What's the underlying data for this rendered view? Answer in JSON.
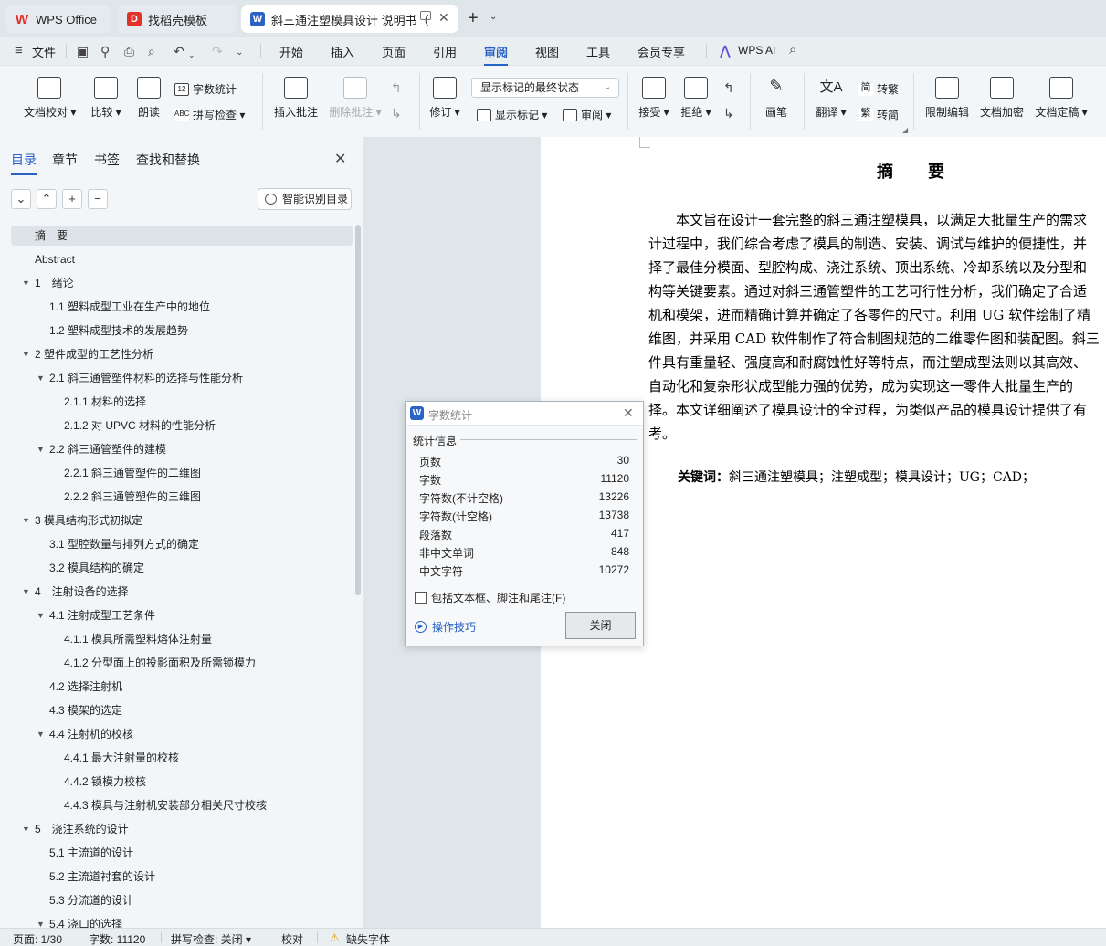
{
  "tabs": [
    {
      "label": "WPS Office"
    },
    {
      "label": "找稻壳模板"
    },
    {
      "label": "斜三通注塑模具设计 说明书（"
    }
  ],
  "menu": {
    "file": "文件",
    "items": [
      "开始",
      "插入",
      "页面",
      "引用",
      "审阅",
      "视图",
      "工具",
      "会员专享"
    ],
    "active": "审阅",
    "ai": "WPS AI"
  },
  "ribbon": {
    "doc_check": "文档校对",
    "compare": "比较",
    "read_aloud": "朗读",
    "word_count": "字数统计",
    "spell_check": "拼写检查",
    "insert_comment": "插入批注",
    "delete_comment": "删除批注",
    "revise": "修订",
    "markup_state": "显示标记的最终状态",
    "show_markup": "显示标记",
    "review_pane": "审阅",
    "accept": "接受",
    "reject": "拒绝",
    "pen": "画笔",
    "translate": "翻译",
    "to_traditional": "转繁",
    "to_simplified": "转简",
    "restrict_edit": "限制编辑",
    "encrypt": "文档加密",
    "finalize": "文档定稿"
  },
  "nav": {
    "tabs": [
      "目录",
      "章节",
      "书签",
      "查找和替换"
    ],
    "smart_toc": "智能识别目录",
    "toc": [
      {
        "text": "摘　要",
        "level": 1,
        "caret": false,
        "selected": true
      },
      {
        "text": "Abstract",
        "level": 1,
        "caret": false
      },
      {
        "text": "1　绪论",
        "level": 1,
        "caret": true
      },
      {
        "text": "1.1  塑料成型工业在生产中的地位",
        "level": 2,
        "caret": false
      },
      {
        "text": "1.2  塑料成型技术的发展趋势",
        "level": 2,
        "caret": false
      },
      {
        "text": "2 塑件成型的工艺性分析",
        "level": 1,
        "caret": true
      },
      {
        "text": "2.1 斜三通管塑件材料的选择与性能分析",
        "level": 2,
        "caret": true
      },
      {
        "text": "2.1.1 材料的选择",
        "level": 3,
        "caret": false
      },
      {
        "text": "2.1.2  对 UPVC 材料的性能分析",
        "level": 3,
        "caret": false
      },
      {
        "text": "2.2 斜三通管塑件的建模",
        "level": 2,
        "caret": true
      },
      {
        "text": "2.2.1 斜三通管塑件的二维图",
        "level": 3,
        "caret": false
      },
      {
        "text": "2.2.2 斜三通管塑件的三维图",
        "level": 3,
        "caret": false
      },
      {
        "text": "3 模具结构形式初拟定",
        "level": 1,
        "caret": true
      },
      {
        "text": "3.1 型腔数量与排列方式的确定",
        "level": 2,
        "caret": false
      },
      {
        "text": "3.2 模具结构的确定",
        "level": 2,
        "caret": false
      },
      {
        "text": "4　注射设备的选择",
        "level": 1,
        "caret": true
      },
      {
        "text": "4.1  注射成型工艺条件",
        "level": 2,
        "caret": true
      },
      {
        "text": "4.1.1  模具所需塑料熔体注射量",
        "level": 3,
        "caret": false
      },
      {
        "text": "4.1.2  分型面上的投影面积及所需锁模力",
        "level": 3,
        "caret": false
      },
      {
        "text": "4.2  选择注射机",
        "level": 2,
        "caret": false
      },
      {
        "text": "4.3  模架的选定",
        "level": 2,
        "caret": false
      },
      {
        "text": "4.4  注射机的校核",
        "level": 2,
        "caret": true
      },
      {
        "text": "4.4.1  最大注射量的校核",
        "level": 3,
        "caret": false
      },
      {
        "text": "4.4.2  锁模力校核",
        "level": 3,
        "caret": false
      },
      {
        "text": "4.4.3  模具与注射机安装部分相关尺寸校核",
        "level": 3,
        "caret": false
      },
      {
        "text": "5　浇注系统的设计",
        "level": 1,
        "caret": true
      },
      {
        "text": "5.1  主流道的设计",
        "level": 2,
        "caret": false
      },
      {
        "text": "5.2  主流道衬套的设计",
        "level": 2,
        "caret": false
      },
      {
        "text": "5.3  分流道的设计",
        "level": 2,
        "caret": false
      },
      {
        "text": "5.4  浇口的选择",
        "level": 2,
        "caret": true
      }
    ]
  },
  "document": {
    "title": "摘　要",
    "lines": [
      "　　本文旨在设计一套完整的斜三通注塑模具，以满足大批量生产的需求",
      "计过程中，我们综合考虑了模具的制造、安装、调试与维护的便捷性，并",
      "择了最佳分模面、型腔构成、浇注系统、顶出系统、冷却系统以及分型和",
      "构等关键要素。通过对斜三通管塑件的工艺可行性分析，我们确定了合适",
      "机和模架，进而精确计算并确定了各零件的尺寸。利用 UG 软件绘制了精",
      "维图，并采用 CAD 软件制作了符合制图规范的二维零件图和装配图。斜三",
      "件具有重量轻、强度高和耐腐蚀性好等特点，而注塑成型法则以其高效、",
      "自动化和复杂形状成型能力强的优势，成为实现这一零件大批量生产的",
      "择。本文详细阐述了模具设计的全过程，为类似产品的模具设计提供了有",
      "考。"
    ],
    "keywords_label": "关键词：",
    "keywords": "斜三通注塑模具；注塑成型；模具设计；UG；CAD；"
  },
  "dialog": {
    "title": "字数统计",
    "section": "统计信息",
    "rows": [
      {
        "label": "页数",
        "value": "30"
      },
      {
        "label": "字数",
        "value": "11120"
      },
      {
        "label": "字符数(不计空格)",
        "value": "13226"
      },
      {
        "label": "字符数(计空格)",
        "value": "13738"
      },
      {
        "label": "段落数",
        "value": "417"
      },
      {
        "label": "非中文单词",
        "value": "848"
      },
      {
        "label": "中文字符",
        "value": "10272"
      }
    ],
    "checkbox": "包括文本框、脚注和尾注(F)",
    "tips": "操作技巧",
    "close": "关闭"
  },
  "status": {
    "page": "页面: 1/30",
    "words": "字数: 11120",
    "spell": "拼写检查: 关闭",
    "proof": "校对",
    "missing_font": "缺失字体"
  },
  "colors": {
    "accent": "#2a63c4",
    "wps_red": "#e0322b"
  }
}
